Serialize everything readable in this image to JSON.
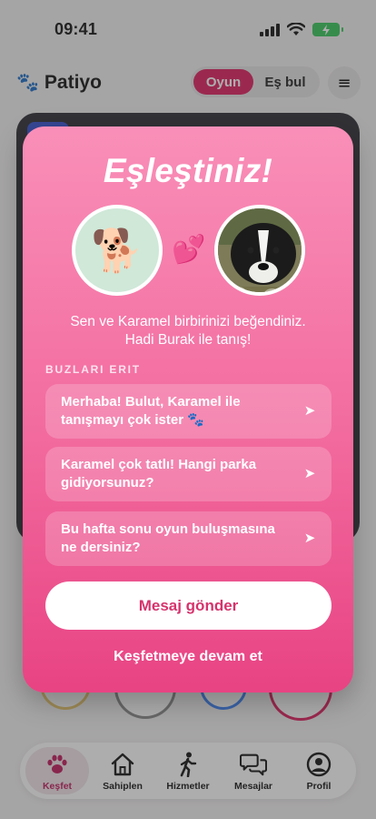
{
  "status_bar": {
    "time": "09:41"
  },
  "header": {
    "app_name": "Patiyo",
    "logo_icon": "paw-icon",
    "mode_tabs": [
      "Oyun",
      "Eş bul"
    ],
    "active_mode": "Oyun"
  },
  "modal": {
    "title": "Eşleştiniz!",
    "message_line1": "Sen ve Karamel birbirinizi beğendiniz.",
    "message_line2": "Hadi Burak ile tanış!",
    "section_label": "BUZLARI ERIT",
    "icebreakers": [
      "Merhaba! Bulut, Karamel ile tanışmayı çok ister 🐾",
      "Karamel çok tatlı! Hangi parka gidiyorsunuz?",
      "Bu hafta sonu oyun buluşmasına ne dersiniz?"
    ],
    "primary_button": "Mesaj gönder",
    "secondary_link": "Keşfetmeye devam et",
    "accent_color": "#e84383"
  },
  "tab_bar": {
    "items": [
      {
        "label": "Keşfet",
        "icon": "paw-icon",
        "active": true
      },
      {
        "label": "Sahiplen",
        "icon": "house-icon",
        "active": false
      },
      {
        "label": "Hizmetler",
        "icon": "walker-icon",
        "active": false
      },
      {
        "label": "Mesajlar",
        "icon": "chat-bubbles-icon",
        "active": false
      },
      {
        "label": "Profil",
        "icon": "person-circle-icon",
        "active": false
      }
    ]
  }
}
